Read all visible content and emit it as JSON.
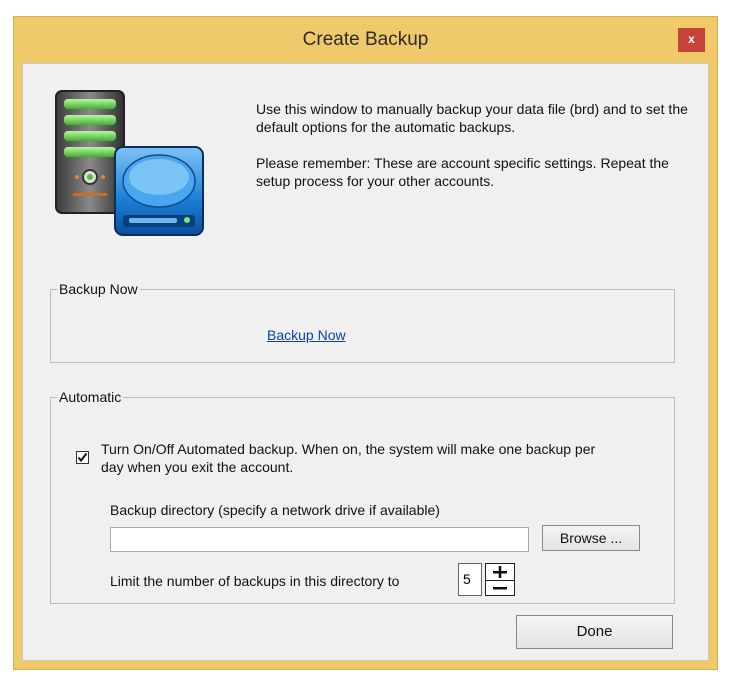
{
  "window": {
    "title": "Create Backup",
    "close_label": "x"
  },
  "intro": {
    "line1": "Use this window to manually backup your data file (brd) and to set the default options for the automatic backups.",
    "line2": "Please remember: These are account specific settings. Repeat the setup process for your other accounts."
  },
  "backup_now_group": {
    "legend": "Backup Now",
    "link_label": "Backup Now"
  },
  "automatic_group": {
    "legend": "Automatic",
    "auto_backup_checked": true,
    "auto_backup_label": "Turn On/Off Automated backup.  When on, the system will make one backup per day when you exit the account.",
    "directory_label": "Backup directory (specify a network drive if available)",
    "directory_value": "",
    "browse_label": "Browse ...",
    "limit_label": "Limit the number of backups in this directory to",
    "limit_value": "5"
  },
  "footer": {
    "done_label": "Done"
  },
  "icons": {
    "backup": "server-drive-icon",
    "check": "checkmark-icon",
    "spin_up": "plus-icon",
    "spin_down": "minus-icon"
  },
  "colors": {
    "titlebar": "#f0c96a",
    "close": "#c7423a",
    "link": "#0a3fb7"
  }
}
